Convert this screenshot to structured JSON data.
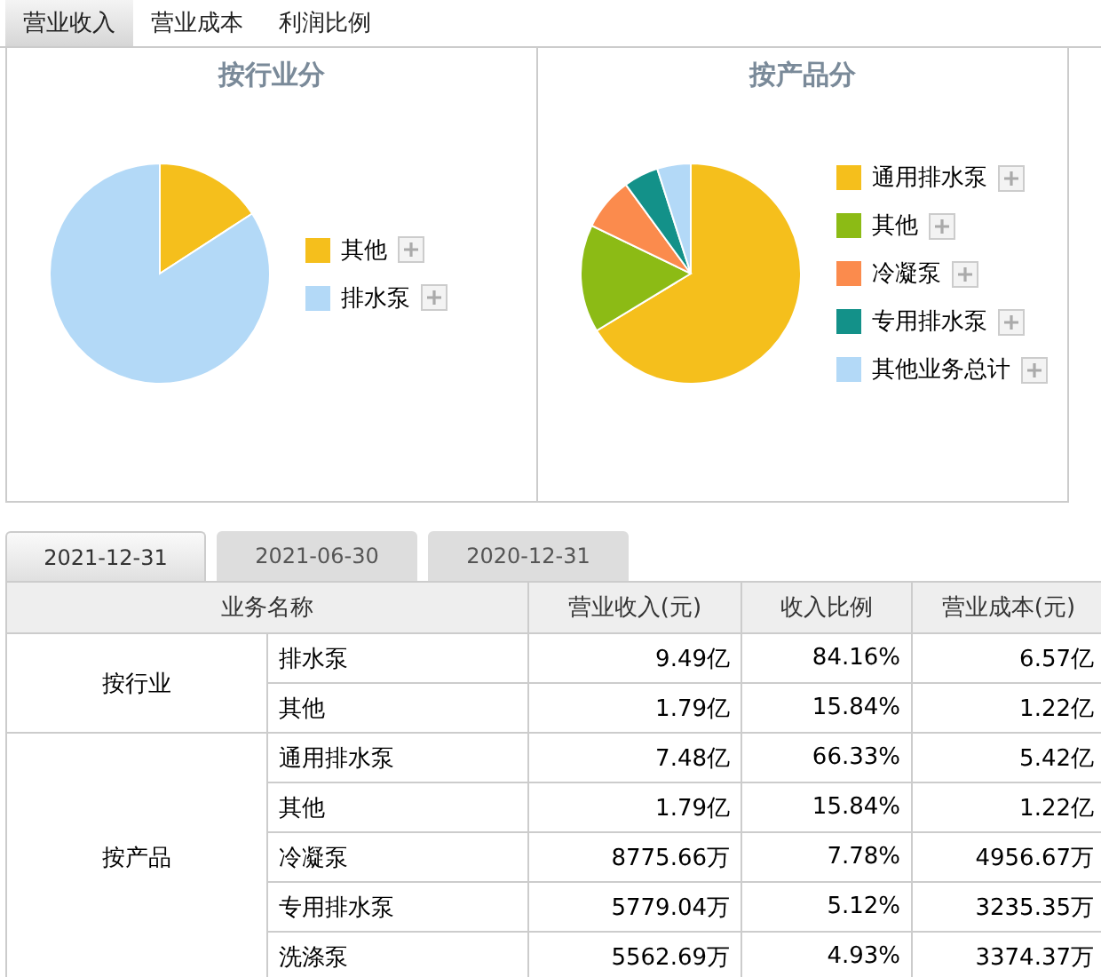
{
  "tabs": [
    {
      "label": "营业收入",
      "selected": true
    },
    {
      "label": "营业成本",
      "selected": false
    },
    {
      "label": "利润比例",
      "selected": false
    }
  ],
  "charts": [
    {
      "title": "按行业分",
      "legend": [
        {
          "label": "其他",
          "color": "#f5bf1c"
        },
        {
          "label": "排水泵",
          "color": "#b3d9f7"
        }
      ]
    },
    {
      "title": "按产品分",
      "legend": [
        {
          "label": "通用排水泵",
          "color": "#f5bf1c"
        },
        {
          "label": "其他",
          "color": "#8cbb15"
        },
        {
          "label": "冷凝泵",
          "color": "#fb8b4d"
        },
        {
          "label": "专用排水泵",
          "color": "#139189"
        },
        {
          "label": "其他业务总计",
          "color": "#b3d9f7"
        }
      ]
    }
  ],
  "date_tabs": [
    {
      "label": "2021-12-31",
      "selected": true
    },
    {
      "label": "2021-06-30",
      "selected": false
    },
    {
      "label": "2020-12-31",
      "selected": false
    }
  ],
  "table": {
    "columns": [
      "业务名称",
      "营业收入(元)",
      "收入比例",
      "营业成本(元)"
    ],
    "groups": [
      {
        "label": "按行业",
        "rows": [
          {
            "name": "排水泵",
            "revenue": "9.49亿",
            "ratio": "84.16%",
            "cost": "6.57亿"
          },
          {
            "name": "其他",
            "revenue": "1.79亿",
            "ratio": "15.84%",
            "cost": "1.22亿"
          }
        ]
      },
      {
        "label": "按产品",
        "rows": [
          {
            "name": "通用排水泵",
            "revenue": "7.48亿",
            "ratio": "66.33%",
            "cost": "5.42亿"
          },
          {
            "name": "其他",
            "revenue": "1.79亿",
            "ratio": "15.84%",
            "cost": "1.22亿"
          },
          {
            "name": "冷凝泵",
            "revenue": "8775.66万",
            "ratio": "7.78%",
            "cost": "4956.67万"
          },
          {
            "name": "专用排水泵",
            "revenue": "5779.04万",
            "ratio": "5.12%",
            "cost": "3235.35万"
          },
          {
            "name": "洗涤泵",
            "revenue": "5562.69万",
            "ratio": "4.93%",
            "cost": "3374.37万"
          }
        ]
      }
    ]
  }
}
